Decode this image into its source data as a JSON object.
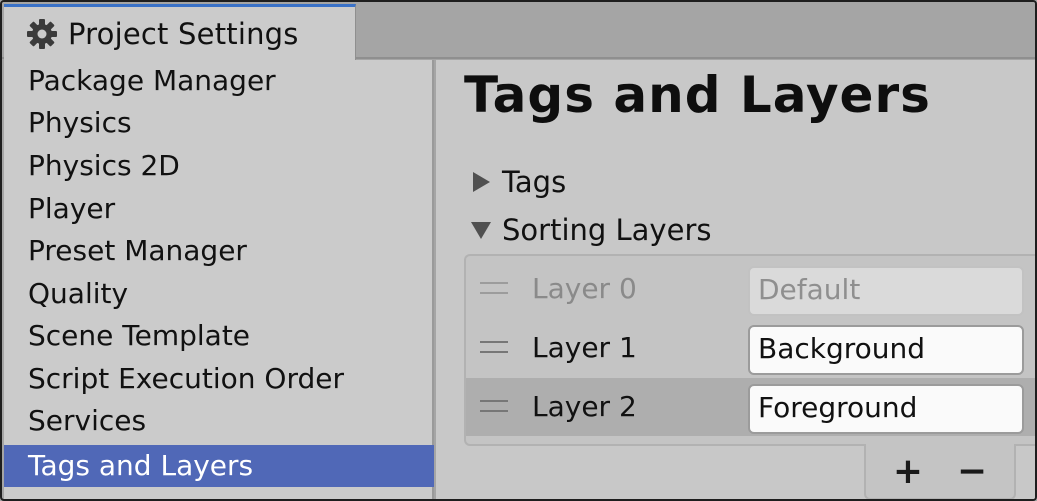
{
  "window": {
    "tab_title": "Project Settings",
    "tab_icon": "gear-icon",
    "accent": "#3a72c8"
  },
  "sidebar": {
    "items": [
      {
        "label": "Package Manager"
      },
      {
        "label": "Physics"
      },
      {
        "label": "Physics 2D"
      },
      {
        "label": "Player"
      },
      {
        "label": "Preset Manager"
      },
      {
        "label": "Quality"
      },
      {
        "label": "Scene Template"
      },
      {
        "label": "Script Execution Order"
      },
      {
        "label": "Services"
      },
      {
        "label": "Tags and Layers"
      }
    ],
    "selected_index": 9,
    "selected_color": "#5068b7"
  },
  "main": {
    "title": "Tags and Layers",
    "sections": [
      {
        "label": "Tags",
        "expanded": false
      },
      {
        "label": "Sorting Layers",
        "expanded": true
      }
    ],
    "sorting_layers": [
      {
        "name": "Layer 0",
        "value": "Default",
        "editable": false
      },
      {
        "name": "Layer 1",
        "value": "Background",
        "editable": true
      },
      {
        "name": "Layer 2",
        "value": "Foreground",
        "editable": true
      }
    ],
    "selected_layer_index": 2,
    "add_label": "+",
    "remove_label": "−"
  }
}
